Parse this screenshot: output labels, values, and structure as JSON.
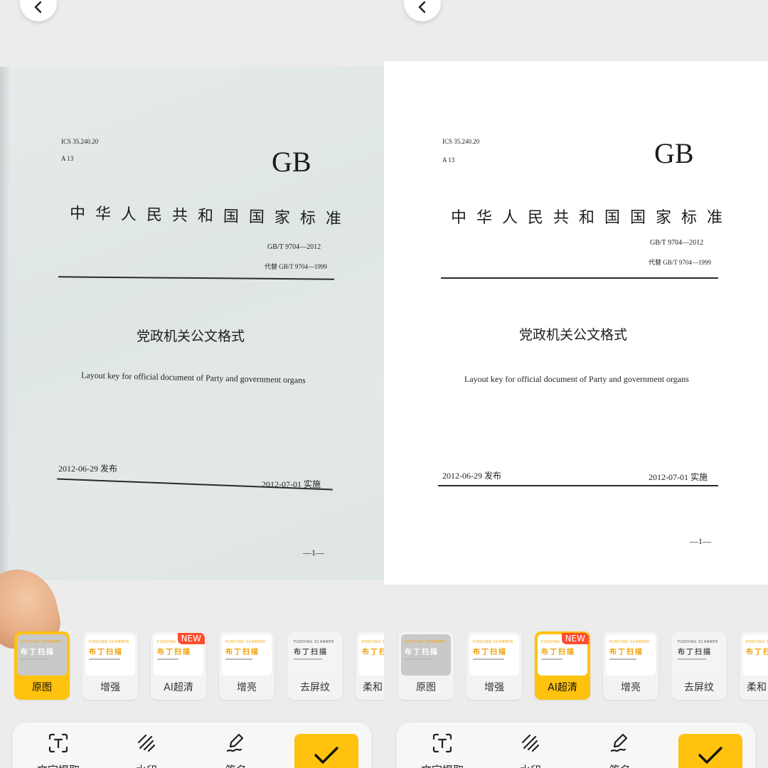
{
  "document": {
    "ics": "ICS 35.240.20",
    "class_code": "A 13",
    "gb_mark": "GB",
    "national_standard": "中华人民共和国国家标准",
    "standard_number": "GB/T   9704—2012",
    "replaces": "代替 GB/T 9704—1999",
    "title_cn": "党政机关公文格式",
    "title_en": "Layout key for official document of Party and government organs",
    "publish_date": "2012-06-29 发布",
    "effective_date": "2012-07-01 实施",
    "page_number": "—1—"
  },
  "filters": {
    "brand_text": "PUDDING SCANNER",
    "brand_title": "布丁扫描",
    "new_badge": "NEW",
    "items": [
      {
        "label": "原图"
      },
      {
        "label": "增强"
      },
      {
        "label": "AI超清"
      },
      {
        "label": "增亮"
      },
      {
        "label": "去屏纹"
      },
      {
        "label": "柔和"
      }
    ]
  },
  "toolbar": {
    "items": [
      {
        "label": "文字提取",
        "icon": "text-extract-icon"
      },
      {
        "label": "水印",
        "icon": "watermark-icon"
      },
      {
        "label": "签名",
        "icon": "signature-icon"
      }
    ],
    "confirm_icon": "check-icon"
  },
  "panels": {
    "left_selected": "原图",
    "right_selected": "AI超清"
  },
  "colors": {
    "accent": "#ffc20e",
    "badge": "#ff4d2e"
  }
}
